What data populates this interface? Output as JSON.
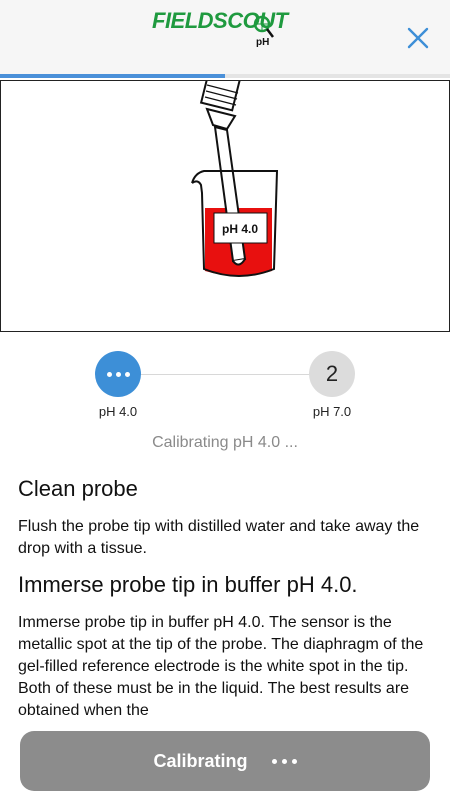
{
  "header": {
    "logo_main": "FIELDSCOUT",
    "logo_sub": "pH",
    "close_icon": "close-x-icon",
    "progress_fraction": 0.5
  },
  "illustration": {
    "beaker_label": "pH 4.0",
    "liquid_color": "#e8100f"
  },
  "stepper": {
    "steps": [
      {
        "label": "pH 4.0",
        "state": "in-progress",
        "icon": "ellipsis-icon"
      },
      {
        "label": "pH 7.0",
        "number": "2",
        "state": "pending"
      }
    ],
    "status_text": "Calibrating pH 4.0 ..."
  },
  "instructions": {
    "section1_title": "Clean probe",
    "section1_text": "Flush the probe tip with distilled water and take away the drop with a tissue.",
    "section2_title": "Immerse probe tip in buffer pH 4.0.",
    "section2_text": "Immerse probe tip in buffer pH 4.0. The sensor is the metallic spot at the tip of the probe. The diaphragm of the gel-filled reference electrode is the white spot in the tip. Both of these must be in the liquid. The best results are obtained when the"
  },
  "bottom_button": {
    "label": "Calibrating",
    "icon": "ellipsis-icon"
  },
  "colors": {
    "accent": "#3d8fd7",
    "brand_green": "#1f9a3f",
    "button_disabled": "#8c8c8c"
  }
}
